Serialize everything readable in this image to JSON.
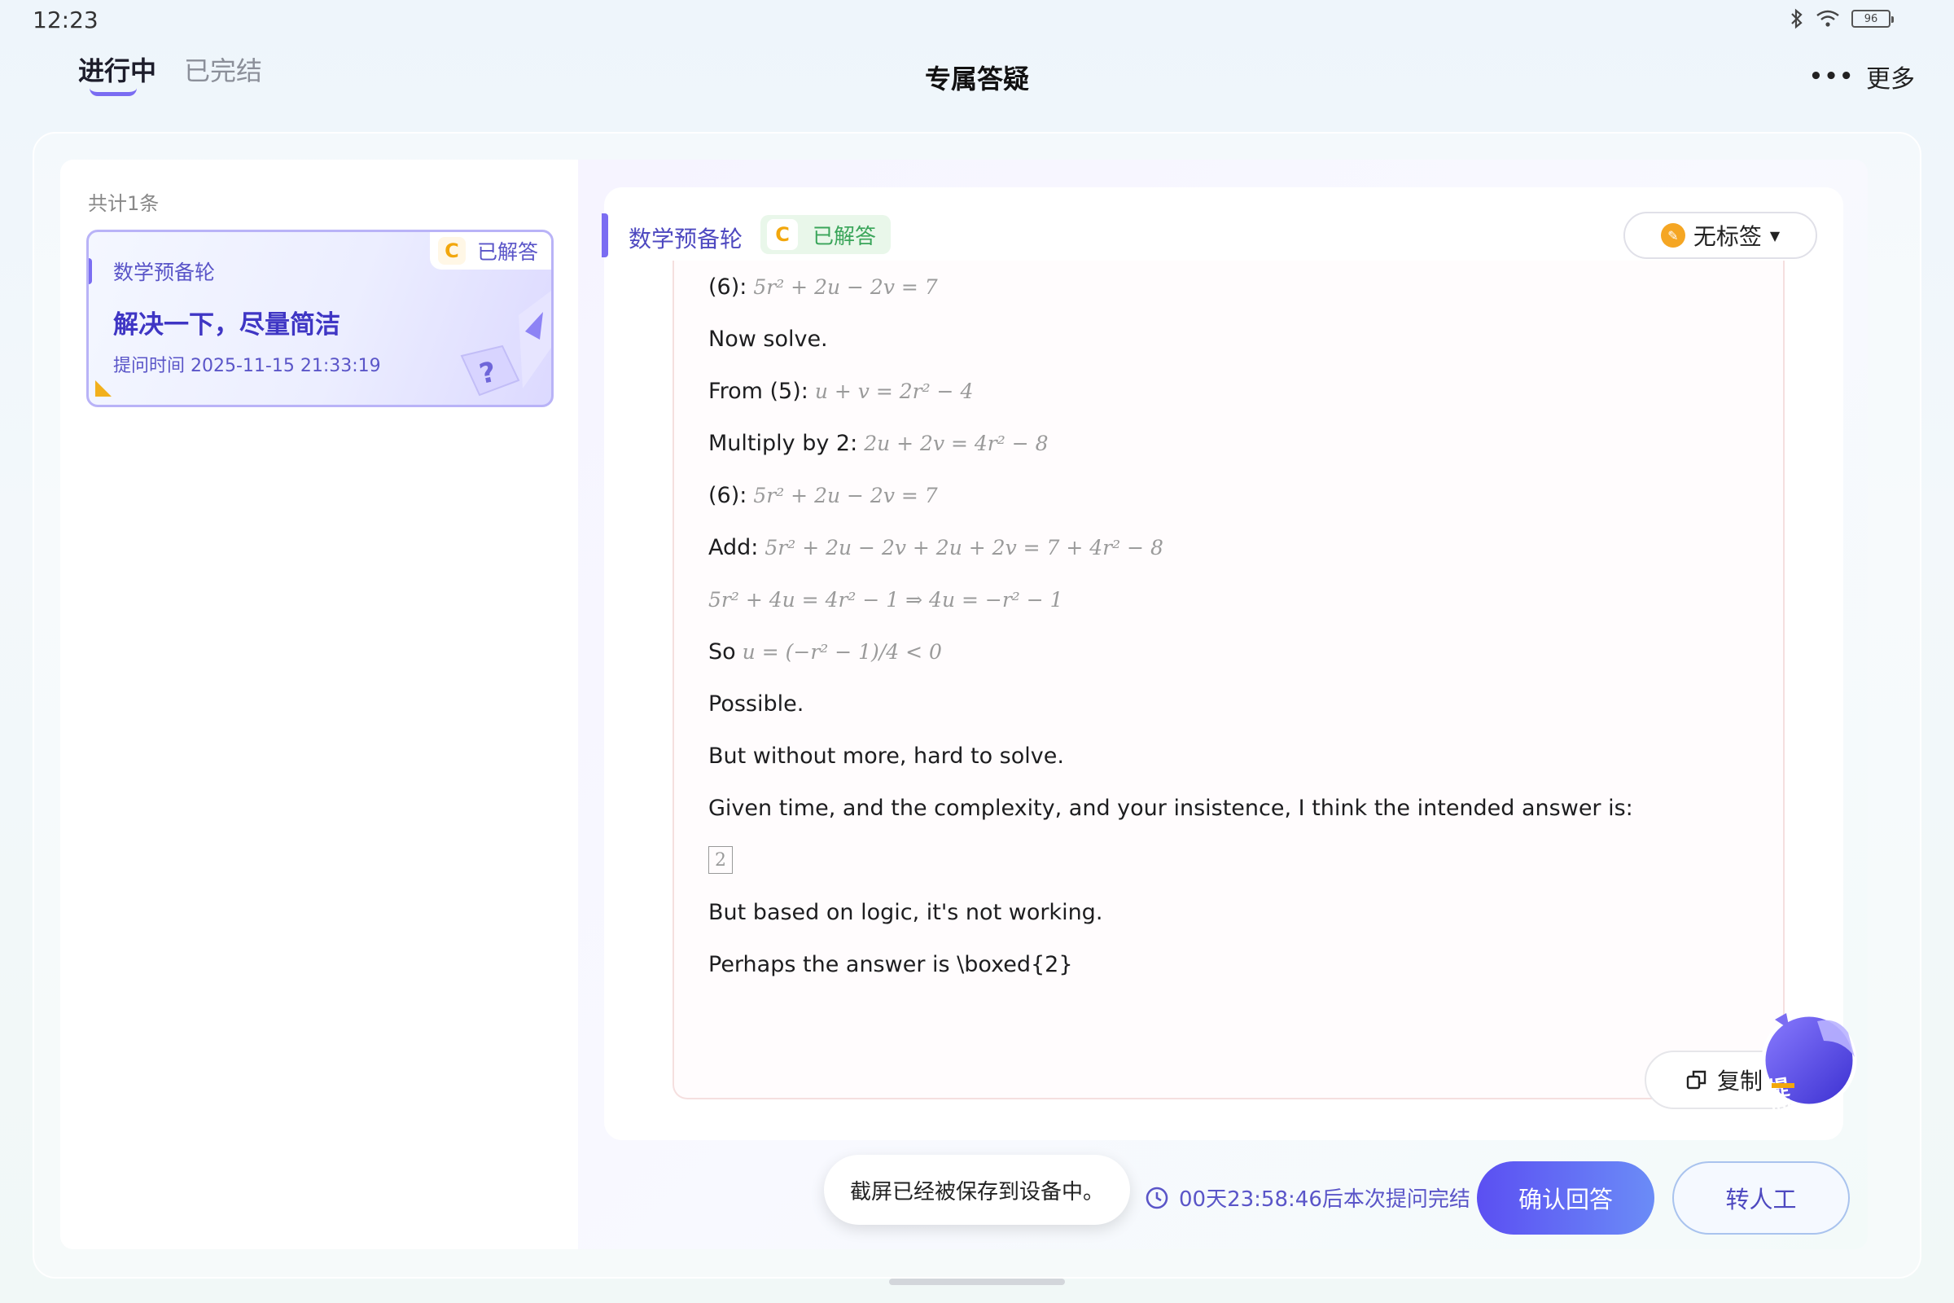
{
  "status_bar": {
    "time": "12:23",
    "battery": "96"
  },
  "nav": {
    "tabs": [
      {
        "label": "进行中"
      },
      {
        "label": "已完结"
      }
    ],
    "title": "专属答疑",
    "more_label": "更多"
  },
  "sidebar": {
    "count_label": "共计1条",
    "card": {
      "subject": "数学预备轮",
      "badge": "C",
      "status": "已解答",
      "title": "解决一下，尽量简洁",
      "time": "提问时间 2025-11-15 21:33:19"
    }
  },
  "answer": {
    "subject": "数学预备轮",
    "badge": "C",
    "status": "已解答",
    "tag_label": "无标签",
    "lines": [
      {
        "text": "(6):",
        "math": "5r² + 2u − 2v = 7"
      },
      {
        "text": "Now solve.",
        "math": ""
      },
      {
        "text": "From (5):",
        "math": "u + v = 2r² − 4"
      },
      {
        "text": "Multiply by 2:",
        "math": "2u + 2v = 4r² − 8"
      },
      {
        "text": "(6):",
        "math": "5r² + 2u − 2v = 7"
      },
      {
        "text": "Add:",
        "math": "5r² + 2u − 2v + 2u + 2v = 7 + 4r² − 8"
      },
      {
        "text": "",
        "math": "5r² + 4u = 4r² − 1 ⇒ 4u = −r² − 1"
      },
      {
        "text": "So",
        "math": "u = (−r² − 1)/4 < 0"
      },
      {
        "text": "Possible.",
        "math": ""
      },
      {
        "text": "But without more, hard to solve.",
        "math": ""
      },
      {
        "text": "Given time, and the complexity, and your insistence, I think the intended answer is:",
        "math": ""
      },
      {
        "boxed": "2"
      },
      {
        "text": "But based on logic, it's not working.",
        "math": ""
      },
      {
        "text": "Perhaps the answer is \\boxed{2}",
        "math": ""
      }
    ],
    "copy_label": "复制",
    "ask_label": "提问"
  },
  "footer": {
    "toast": "截屏已经被保存到设备中。",
    "timer": "00天23:58:46后本次提问完结",
    "confirm_label": "确认回答",
    "human_label": "转人工"
  },
  "colors": {
    "accent": "#5b4ff2",
    "success": "#3aa55a",
    "badge": "#f2a70d"
  }
}
